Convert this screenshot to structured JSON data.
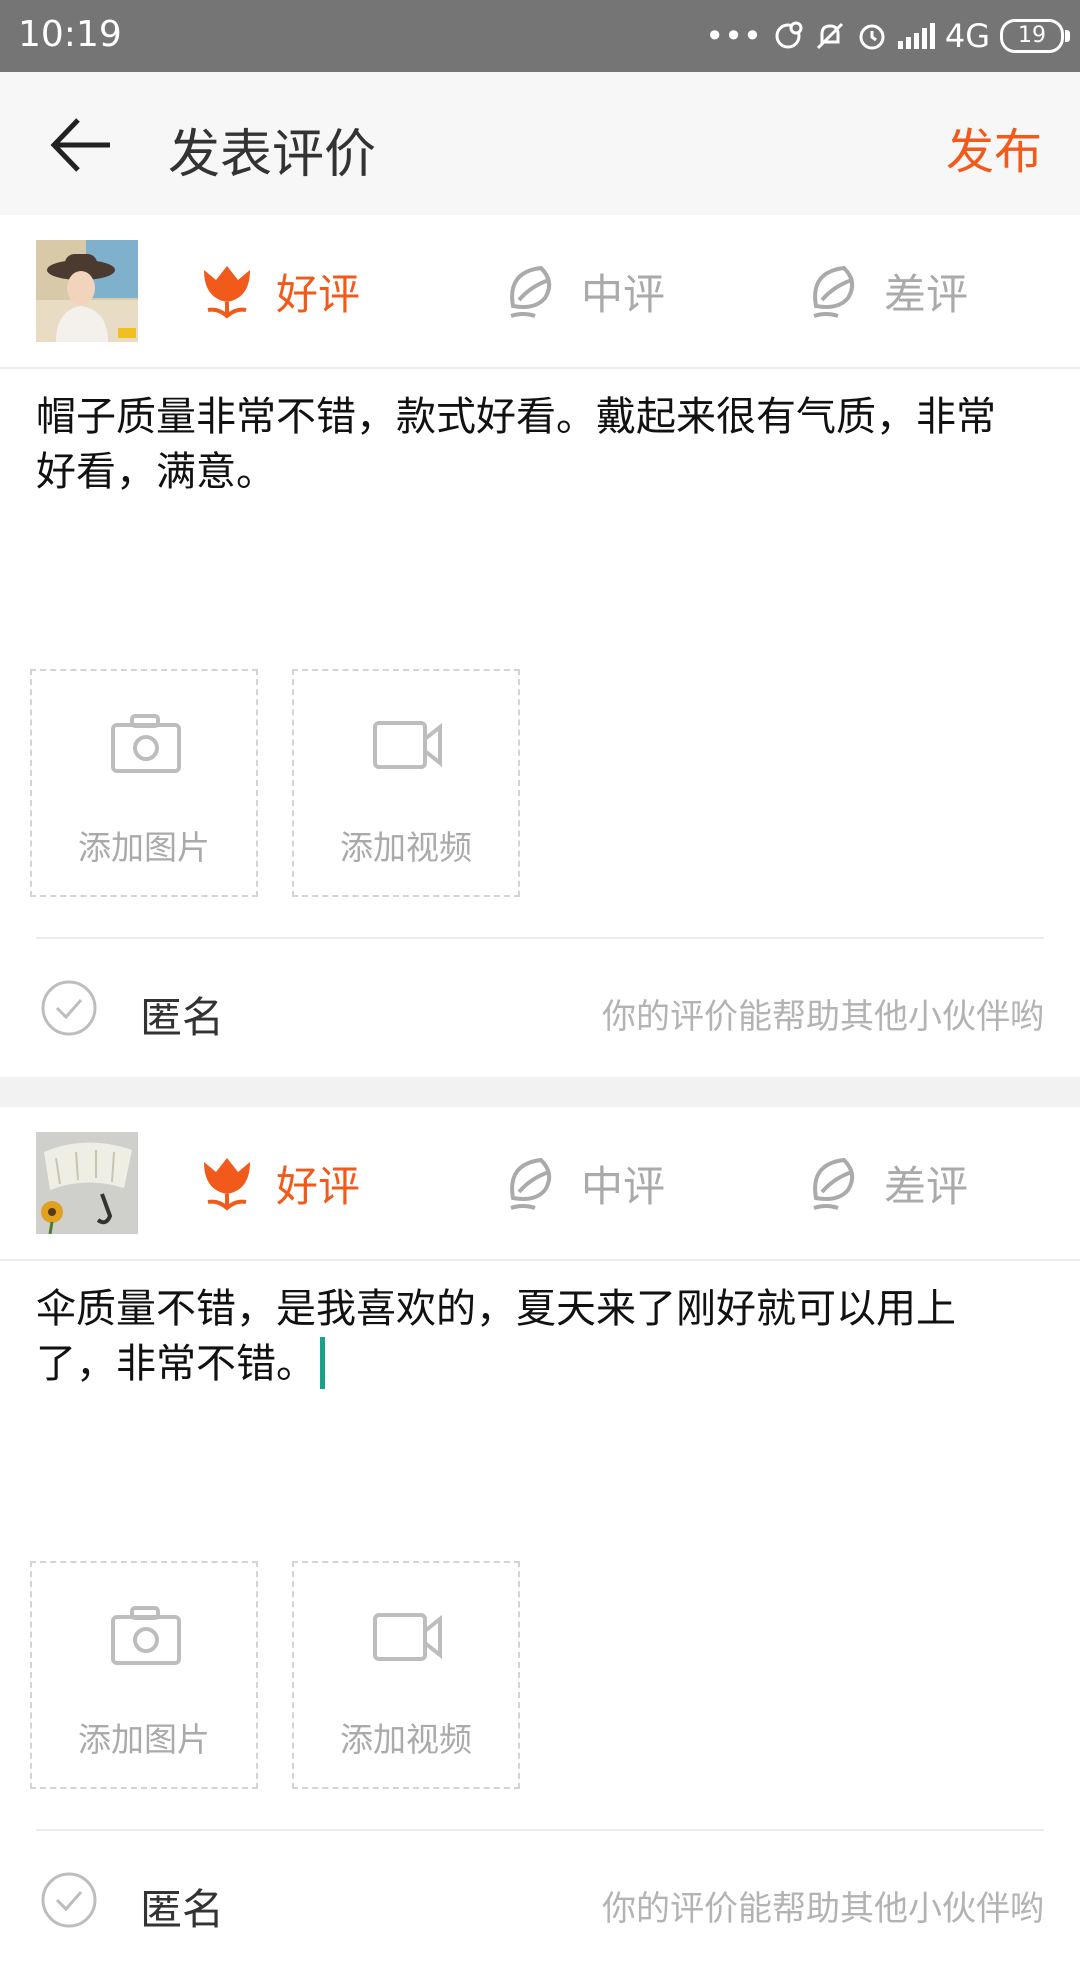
{
  "status_bar": {
    "time": "10:19",
    "network": "4G",
    "battery": "19"
  },
  "header": {
    "title": "发表评价",
    "publish_label": "发布"
  },
  "ratings": {
    "good": "好评",
    "mid": "中评",
    "bad": "差评"
  },
  "add_media": {
    "photo": "添加图片",
    "video": "添加视频"
  },
  "anonymous": {
    "label": "匿名",
    "hint": "你的评价能帮助其他小伙伴哟"
  },
  "reviews": [
    {
      "text_line1": "帽子质量非常不错，款式好看。戴起来很有气质，非常",
      "text_line2": "好看，满意。",
      "selected": "good"
    },
    {
      "text_line1": "伞质量不错，是我喜欢的，夏天来了刚好就可以用上",
      "text_line2": "了，非常不错。",
      "selected": "good"
    }
  ],
  "colors": {
    "accent": "#f25a1b",
    "inactive": "#aaaaaa",
    "cursor": "#19a18a"
  }
}
